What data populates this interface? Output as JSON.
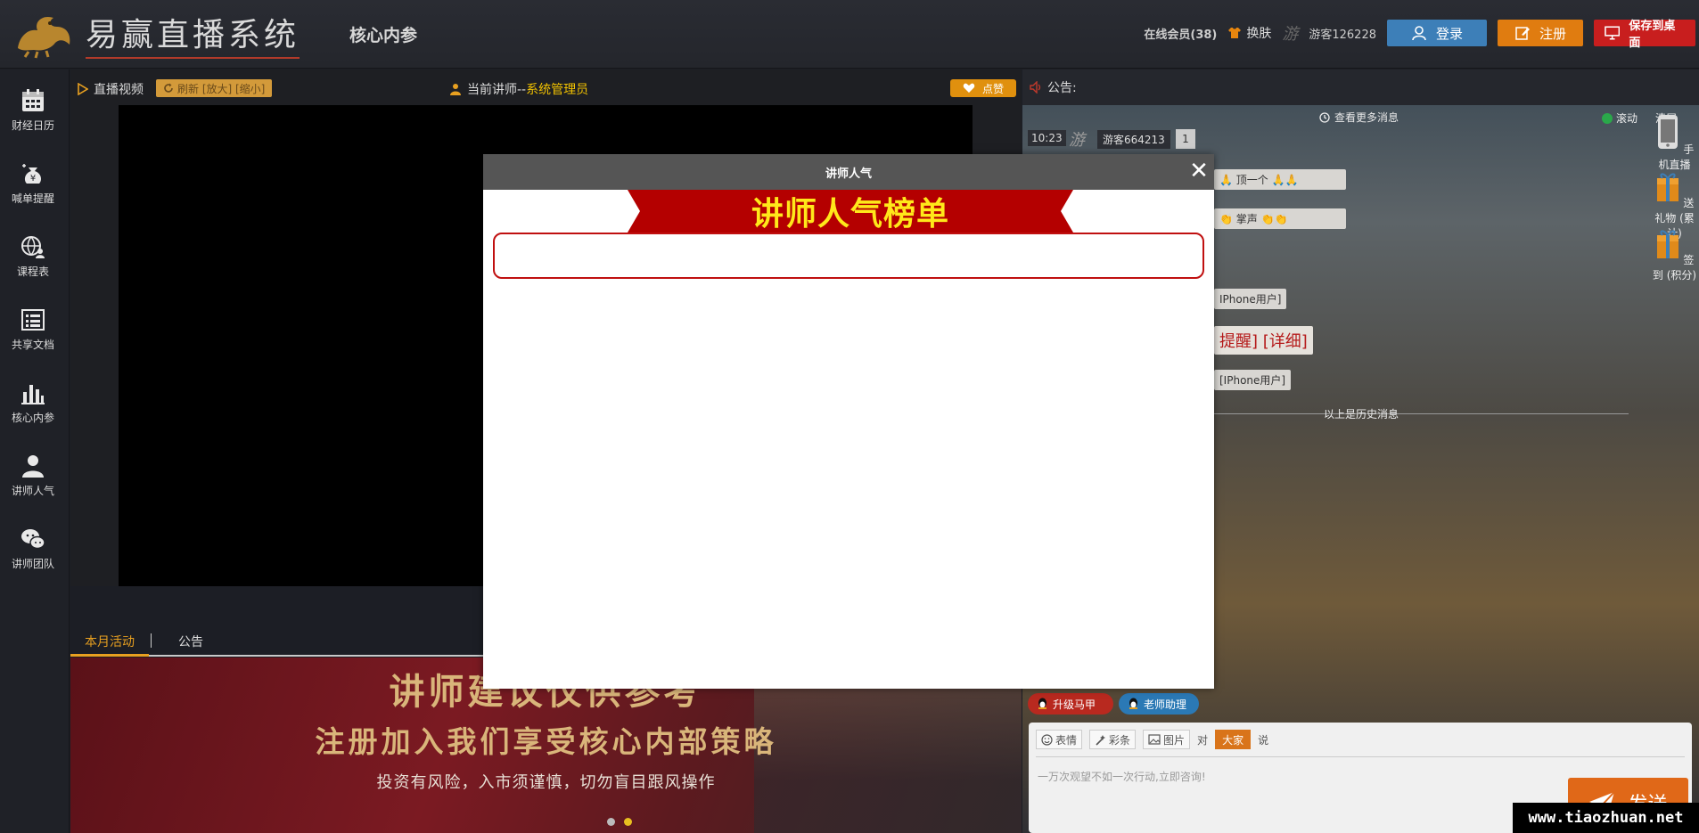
{
  "header": {
    "logo_text": "易赢直播系统",
    "nav_title": "核心内参",
    "online_label": "在线会员(38)",
    "skin_label": "换肤",
    "guest_mark": "游",
    "guest_name": "游客126228",
    "login_label": "登录",
    "register_label": "注册",
    "save_desktop_label": "保存到桌面"
  },
  "sidebar": {
    "items": [
      {
        "label": "财经日历",
        "icon": "calendar-icon"
      },
      {
        "label": "喊单提醒",
        "icon": "money-bag-icon"
      },
      {
        "label": "课程表",
        "icon": "globe-person-icon"
      },
      {
        "label": "共享文档",
        "icon": "document-list-icon"
      },
      {
        "label": "核心内参",
        "icon": "bar-chart-icon"
      },
      {
        "label": "讲师人气",
        "icon": "person-icon"
      },
      {
        "label": "讲师团队",
        "icon": "wechat-icon"
      }
    ]
  },
  "video": {
    "title": "直播视频",
    "refresh_label": "刷新 [放大] [缩小]",
    "lecturer_prefix": "当前讲师--",
    "lecturer_name": "系统管理员",
    "like_label": "点赞"
  },
  "activity": {
    "tabs": [
      "本月活动",
      "公告"
    ],
    "banner_line1": "讲师建议仅供参考",
    "banner_line2": "注册加入我们享受核心内部策略",
    "banner_line3": "投资有风险，入市须谨慎，切勿盲目跟风操作"
  },
  "chat": {
    "notice_label": "公告:",
    "more_messages": "查看更多消息",
    "scroll_label": "滚动",
    "clear_label": "清屏",
    "first_msg": {
      "time": "10:23",
      "you": "游",
      "user": "游客664213",
      "badge": "1"
    },
    "bubbles": {
      "b1": "顶一个",
      "b2": "掌声",
      "b3": "IPhone用户]",
      "b4": "提醒] [详细]",
      "b5": "[IPhone用户]"
    },
    "history_label": "以上是历史消息",
    "side_tools": [
      "手机直播",
      "送礼物 (累计)",
      "签到 (积分)"
    ],
    "chip_upgrade": "升级马甲",
    "chip_assistant": "老师助理",
    "emoji_label": "表情",
    "colorbar_label": "彩条",
    "image_label": "图片",
    "to_label": "对",
    "target_label": "大家",
    "say_label": "说",
    "input_placeholder": "一万次观望不如一次行动,立即咨询!",
    "send_label": "发送"
  },
  "modal": {
    "title": "讲师人气",
    "close": "✕",
    "ribbon_title": "讲师人气榜单"
  },
  "watermark": "www.tiaozhuan.net",
  "colors": {
    "accent_orange": "#e07c10",
    "accent_red": "#c81e1e",
    "login_blue": "#3d7fb8",
    "ribbon_red": "#b40000",
    "ribbon_text": "#ffe81a"
  }
}
